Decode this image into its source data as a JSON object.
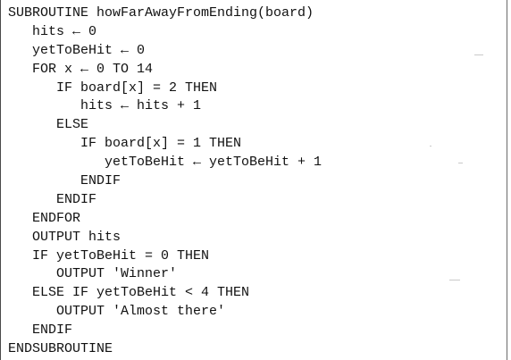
{
  "code": {
    "lines": [
      "SUBROUTINE howFarAwayFromEnding(board)",
      "   hits ← 0",
      "   yetToBeHit ← 0",
      "   FOR x ← 0 TO 14",
      "      IF board[x] = 2 THEN",
      "         hits ← hits + 1",
      "      ELSE",
      "         IF board[x] = 1 THEN",
      "            yetToBeHit ← yetToBeHit + 1",
      "         ENDIF",
      "      ENDIF",
      "   ENDFOR",
      "   OUTPUT hits",
      "   IF yetToBeHit = 0 THEN",
      "      OUTPUT 'Winner'",
      "   ELSE IF yetToBeHit < 4 THEN",
      "      OUTPUT 'Almost there'",
      "   ENDIF",
      "ENDSUBROUTINE"
    ]
  }
}
